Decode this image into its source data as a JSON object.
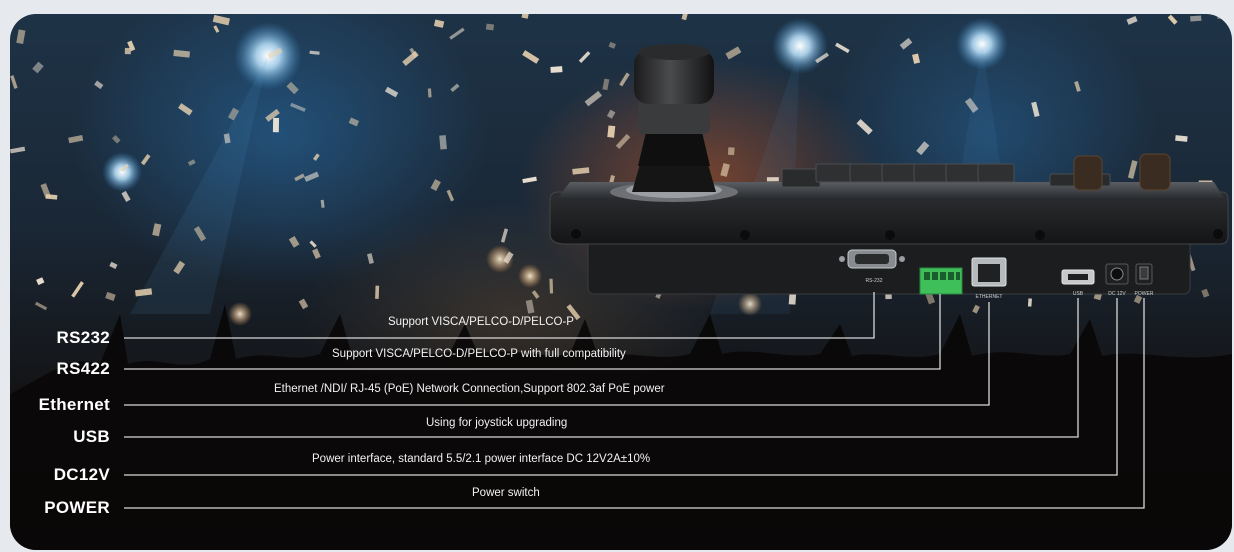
{
  "ports": [
    {
      "label": "RS232",
      "description": "Support VISCA/PELCO-D/PELCO-P"
    },
    {
      "label": "RS422",
      "description": "Support VISCA/PELCO-D/PELCO-P with full compatibility"
    },
    {
      "label": "Ethernet",
      "description": "Ethernet /NDI/ RJ-45 (PoE) Network Connection,Support 802.3af PoE power"
    },
    {
      "label": "USB",
      "description": "Using for joystick upgrading"
    },
    {
      "label": "DC12V",
      "description": "Power interface, standard 5.5/2.1 power interface DC 12V2A±10%"
    },
    {
      "label": "POWER",
      "description": "Power switch"
    }
  ],
  "device_port_tags": {
    "rs232": "RS-232",
    "ethernet": "ETHERNET",
    "usb": "USB",
    "dc": "DC 12V",
    "power": "POWER"
  },
  "colors": {
    "leader_line": "#d8d8d8",
    "text": "#ffffff",
    "terminal_block": "#3fbf5a"
  }
}
